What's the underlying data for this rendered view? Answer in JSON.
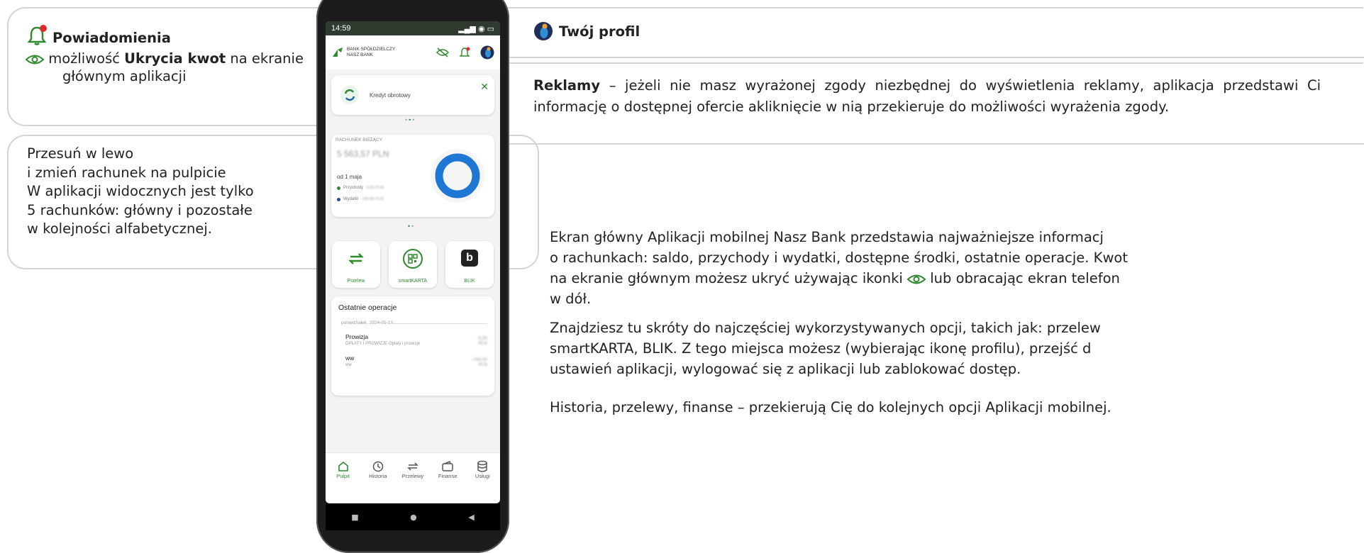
{
  "left_callouts": {
    "notif": {
      "title": "Powiadomienia",
      "line1_pre": "możliwość ",
      "line1_bold": "Ukrycia kwot",
      "line1_post": " na ekranie",
      "line2": "głównym aplikacji"
    },
    "accounts": {
      "lines": [
        "Przesuń w lewo",
        "i zmień rachunek na pulpicie",
        "W aplikacji widocznych jest tylko",
        "5 rachunków: główny i pozostałe",
        "w kolejności alfabetycznej."
      ]
    }
  },
  "right_callouts": {
    "profile": {
      "title": "Twój profil"
    },
    "ads": {
      "bold": "Reklamy",
      "text": " – jeżeli nie masz wyrażonej zgody niezbędnej do wyświetlenia reklamy, aplikacja przedstawi Ci informację o dostępnej ofercie akliknięcie w nią przekieruje do możliwości wyrażenia zgody."
    }
  },
  "description": {
    "p1_a": "Ekran główny Aplikacji mobilnej Nasz Bank przedstawia najważniejsze informacj",
    "p1_b": "o rachunkach: saldo, przychody i wydatki, dostępne środki, ostatnie operacje. Kwot",
    "p1_c_pre": "na ekranie głównym możesz ukryć używając ikonki ",
    "p1_c_post": " lub obracając ekran telefon",
    "p1_d": "w dół.",
    "p2_a": "Znajdziesz tu skróty do najczęściej wykorzystywanych opcji, takich jak: przelew",
    "p2_b": "smartKARTA, BLIK. Z tego miejsca możesz (wybierając ikonę profilu), przejść d",
    "p2_c": "ustawień aplikacji, wylogować się z aplikacji lub zablokować dostęp.",
    "p3": "Historia, przelewy, finanse – przekierują Cię do kolejnych opcji Aplikacji mobilnej."
  },
  "phone": {
    "time": "14:59",
    "bank_line1": "BANK SPÓŁDZIELCZY",
    "bank_line2": "NASZ BANK",
    "promo_label": "Kredyt obrotowy",
    "account_label": "RACHUNEK BIEŻĄCY",
    "balance_blur": "5 563,57 PLN",
    "period": "od 1 maja",
    "income_label": "Przychody",
    "income_blur": "0,00 PLN",
    "expense_label": "Wydatki",
    "expense_blur": "789,46 PLN",
    "tiles": [
      {
        "label": "Przelew"
      },
      {
        "label": "smartKARTA"
      },
      {
        "label": "BLIK"
      }
    ],
    "recent": {
      "title": "Ostatnie operacje",
      "date": "poniedziałek, 2024-05-13",
      "op1_title": "Prowizja",
      "op1_sub": "OPŁATY I PROWIZJE-Opłaty i prowizje",
      "op1_amount": "-5,00 PLN",
      "op2_title": "ww",
      "op2_sub": "ww",
      "op2_amount": "-700,00 PLN"
    },
    "nav": [
      {
        "label": "Pulpit"
      },
      {
        "label": "Historia"
      },
      {
        "label": "Przelewy"
      },
      {
        "label": "Finanse"
      },
      {
        "label": "Usługi"
      }
    ]
  },
  "colors": {
    "accent_green": "#2d8a2d",
    "donut_blue": "#1f77d4",
    "alert_red": "#e5262a"
  },
  "icons": [
    "bell-icon",
    "eye-icon",
    "profile-icon",
    "transfer-icon",
    "qr-icon",
    "blik-icon",
    "home-icon",
    "history-icon",
    "wallet-icon",
    "database-icon"
  ]
}
